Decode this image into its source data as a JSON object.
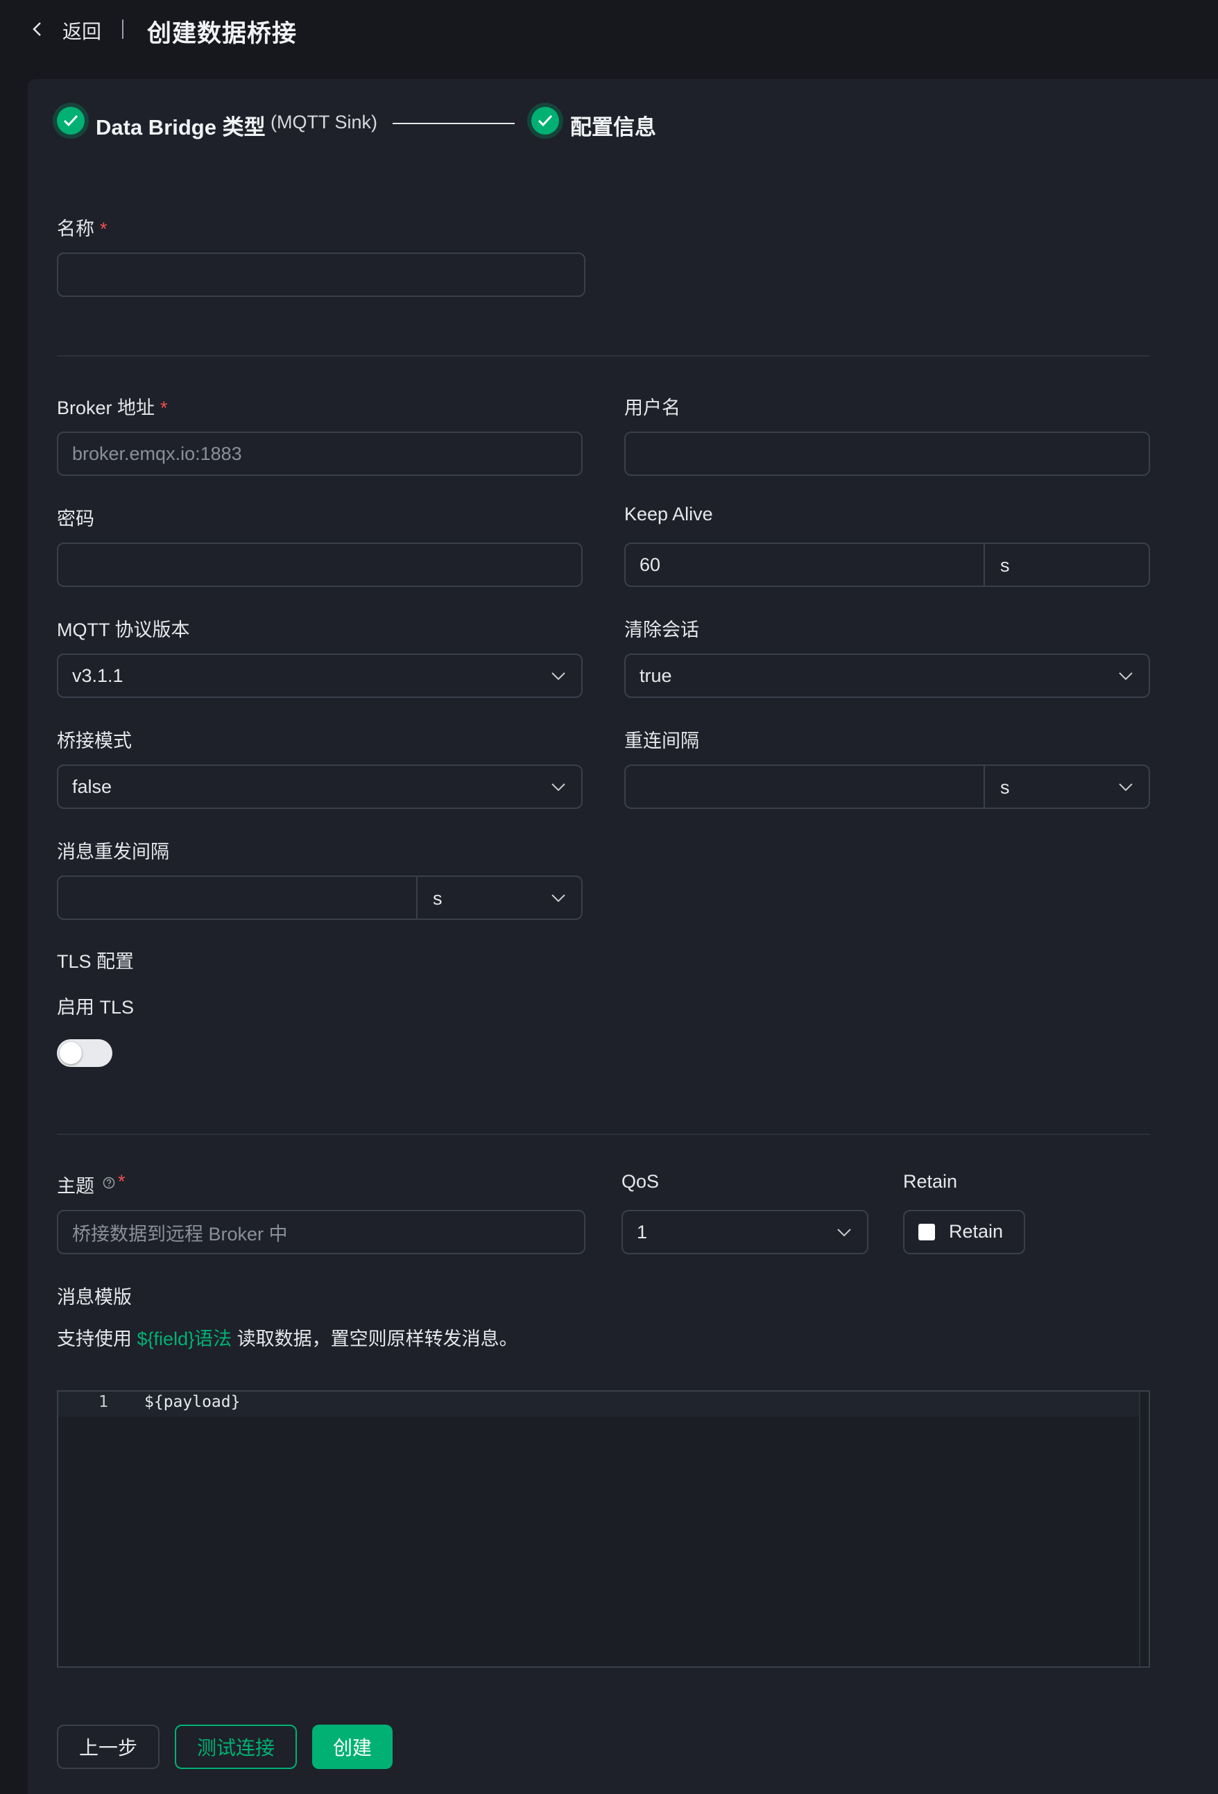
{
  "header": {
    "back_label": "返回",
    "title": "创建数据桥接"
  },
  "steps": [
    {
      "title": "Data Bridge 类型",
      "subtitle": "(MQTT Sink)"
    },
    {
      "title": "配置信息"
    }
  ],
  "form": {
    "name": {
      "label": "名称",
      "required_mark": "*",
      "value": ""
    },
    "broker": {
      "label": "Broker 地址",
      "required_mark": "*",
      "placeholder": "broker.emqx.io:1883"
    },
    "username": {
      "label": "用户名",
      "value": ""
    },
    "password": {
      "label": "密码",
      "value": ""
    },
    "keep_alive": {
      "label": "Keep Alive",
      "value": "60",
      "unit": "s"
    },
    "mqtt_version": {
      "label": "MQTT 协议版本",
      "value": "v3.1.1"
    },
    "clean_session": {
      "label": "清除会话",
      "value": "true"
    },
    "bridge_mode": {
      "label": "桥接模式",
      "value": "false"
    },
    "reconnect_interval": {
      "label": "重连间隔",
      "value": "",
      "unit": "s"
    },
    "retry_interval": {
      "label": "消息重发间隔",
      "value": "",
      "unit": "s"
    },
    "tls": {
      "section_label": "TLS 配置",
      "enable_label": "启用 TLS",
      "enabled": false
    },
    "topic": {
      "label": "主题",
      "required_mark": "*",
      "placeholder": "桥接数据到远程 Broker 中"
    },
    "qos": {
      "label": "QoS",
      "value": "1"
    },
    "retain": {
      "label": "Retain",
      "checkbox_label": "Retain",
      "checked": false
    },
    "template": {
      "label": "消息模版",
      "hint_prefix": "支持使用 ",
      "hint_link": "${field}语法",
      "hint_suffix": " 读取数据，置空则原样转发消息。",
      "line_number": "1",
      "code": "${payload}"
    }
  },
  "buttons": {
    "prev": "上一步",
    "test": "测试连接",
    "create": "创建"
  },
  "colors": {
    "accent": "#00b173",
    "background": "#16181d",
    "card": "#1e2129",
    "required": "#f05050"
  }
}
